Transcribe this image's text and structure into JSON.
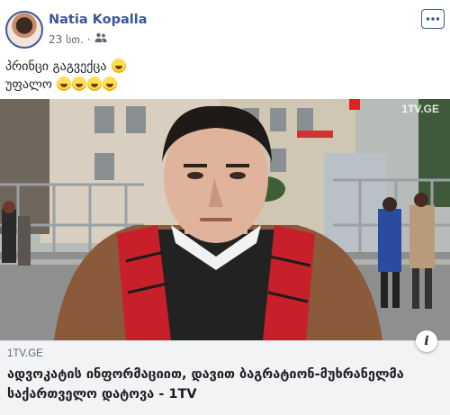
{
  "post": {
    "author": "Natia Kopalla",
    "timestamp": "23 სთ.",
    "separator": "·",
    "audience_icon": "friends-icon",
    "text_line1": "პრინცი გაგვექცა",
    "text_line2": "უფალო"
  },
  "photo": {
    "watermark": "1TV.GE"
  },
  "link_preview": {
    "domain": "1TV.GE",
    "headline": "ადვოკატის ინფორმაციით, დავით ბაგრატიონ-მუხრანელმა საქართველო დატოვა - 1TV",
    "info_icon": "i"
  },
  "colors": {
    "brand_blue": "#385898",
    "preview_bg": "#f2f3f5",
    "meta_gray": "#606770"
  }
}
